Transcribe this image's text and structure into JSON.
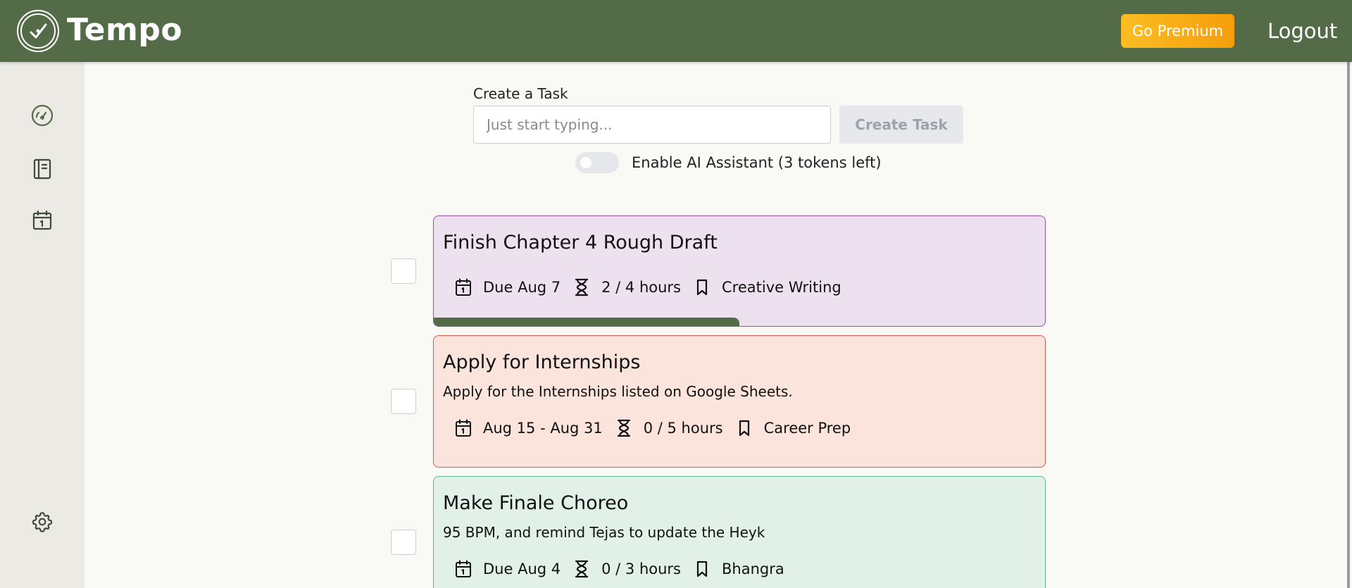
{
  "header": {
    "brand": "Tempo",
    "premium_label": "Go Premium",
    "logout_label": "Logout",
    "bg_color": "#536b46",
    "premium_color": "#fbbd23"
  },
  "sidebar": {
    "items": [
      {
        "name": "dashboard",
        "icon": "speedometer-icon"
      },
      {
        "name": "notebook",
        "icon": "notebook-icon"
      },
      {
        "name": "calendar",
        "icon": "calendar-icon"
      },
      {
        "name": "settings",
        "icon": "gear-icon"
      }
    ]
  },
  "create": {
    "label": "Create a Task",
    "placeholder": "Just start typing...",
    "value": "",
    "button_label": "Create Task",
    "ai_label": "Enable AI Assistant (3 tokens left)",
    "ai_enabled": false
  },
  "tasks": [
    {
      "title": "Finish Chapter 4 Rough Draft",
      "description": "",
      "due": "Due Aug 7",
      "hours": "2 / 4 hours",
      "category": "Creative Writing",
      "progress": 0.5,
      "color": "#ede0ef",
      "border": "#9b4ea8"
    },
    {
      "title": "Apply for Internships",
      "description": "Apply for the Internships listed on Google Sheets.",
      "due": "Aug 15 - Aug 31",
      "hours": "0 / 5 hours",
      "category": "Career Prep",
      "progress": 0,
      "color": "#fae4dc",
      "border": "#e0574d"
    },
    {
      "title": "Make Finale Choreo",
      "description": "95 BPM, and remind Tejas to update the Heyk",
      "due": "Due Aug 4",
      "hours": "0 / 3 hours",
      "category": "Bhangra",
      "progress": 0,
      "color": "#e2f1e7",
      "border": "#5cb98b"
    }
  ]
}
